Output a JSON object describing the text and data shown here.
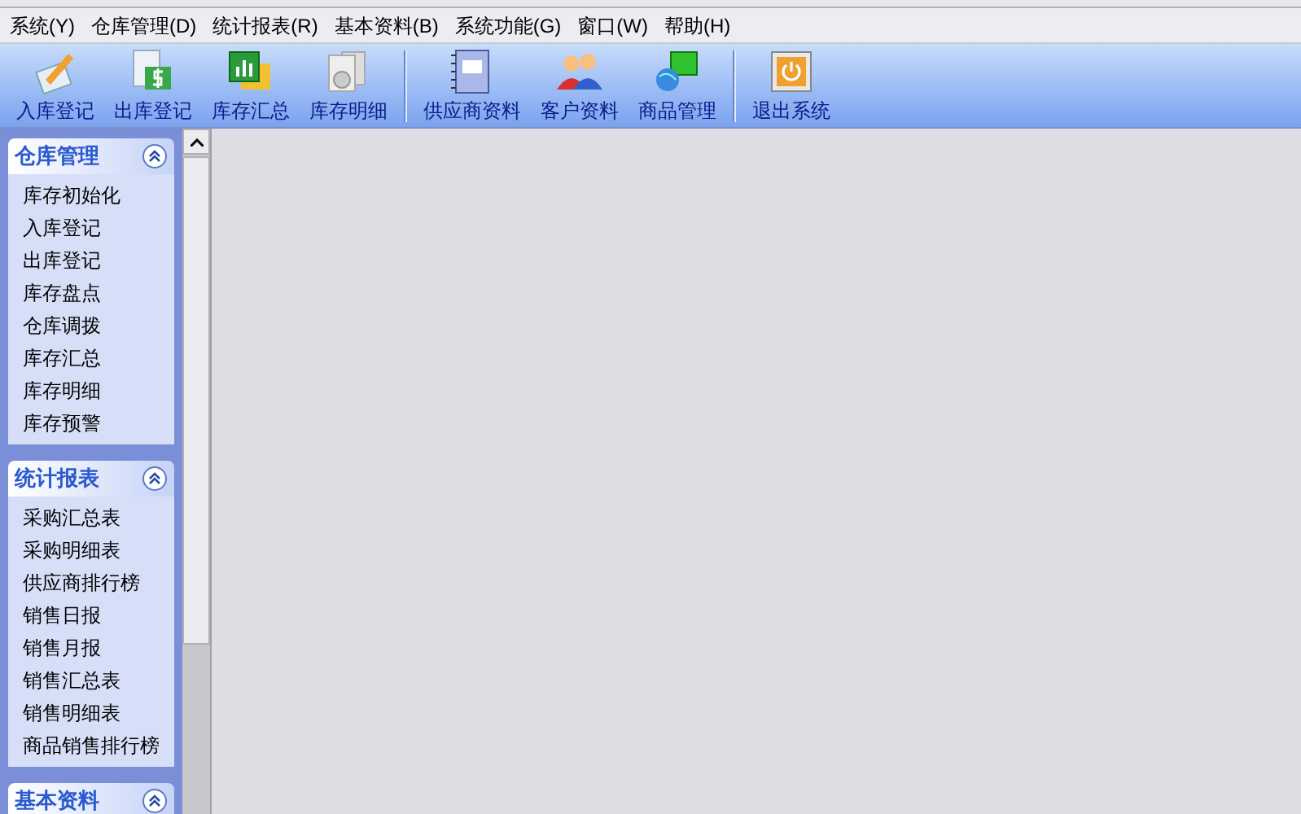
{
  "menu_bar": [
    "系统(Y)",
    "仓库管理(D)",
    "统计报表(R)",
    "基本资料(B)",
    "系统功能(G)",
    "窗口(W)",
    "帮助(H)"
  ],
  "toolbar": [
    {
      "label": "入库登记",
      "kind": "pen"
    },
    {
      "label": "出库登记",
      "kind": "dollar"
    },
    {
      "label": "库存汇总",
      "kind": "chart"
    },
    {
      "label": "库存明细",
      "kind": "disc",
      "sep": true
    },
    {
      "label": "供应商资料",
      "kind": "notebook"
    },
    {
      "label": "客户资料",
      "kind": "people"
    },
    {
      "label": "商品管理",
      "kind": "computer",
      "sep": true
    },
    {
      "label": "退出系统",
      "kind": "power"
    }
  ],
  "sidebar": [
    {
      "title": "仓库管理",
      "expanded": true,
      "items": [
        "库存初始化",
        "入库登记",
        "出库登记",
        "库存盘点",
        "仓库调拨",
        "库存汇总",
        "库存明细",
        "库存预警"
      ]
    },
    {
      "title": "统计报表",
      "expanded": true,
      "items": [
        "采购汇总表",
        "采购明细表",
        "供应商排行榜",
        "销售日报",
        "销售月报",
        "销售汇总表",
        "销售明细表",
        "商品销售排行榜"
      ]
    },
    {
      "title": "基本资料",
      "expanded": true
    }
  ]
}
